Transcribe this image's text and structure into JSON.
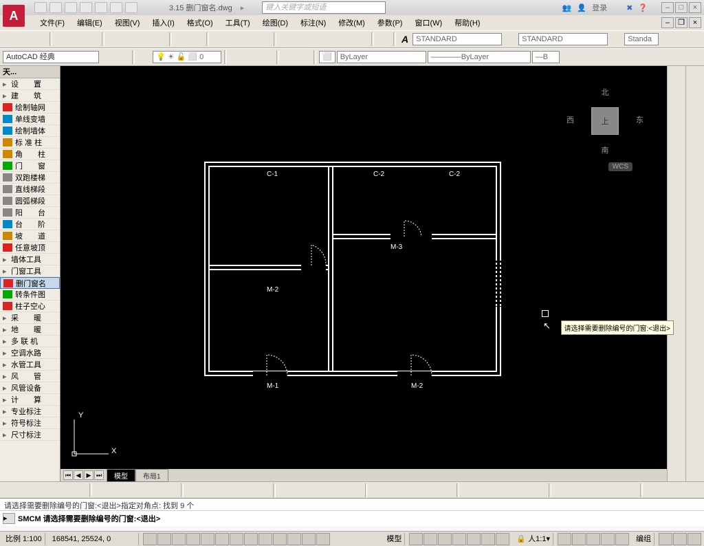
{
  "title": "3.15 删门窗名.dwg",
  "search_placeholder": "键入关键字或短语",
  "login_label": "登录",
  "menus": [
    "文件(F)",
    "编辑(E)",
    "视图(V)",
    "插入(I)",
    "格式(O)",
    "工具(T)",
    "绘图(D)",
    "标注(N)",
    "修改(M)",
    "参数(P)",
    "窗口(W)",
    "帮助(H)"
  ],
  "workspace_combo": "AutoCAD 经典",
  "style_combo1": "STANDARD",
  "style_combo2": "STANDARD",
  "style_combo3": "Standa",
  "layer_combo": "ByLayer",
  "color_combo": "ByLayer",
  "ltype_combo": "B",
  "palette": {
    "title": "天...",
    "items": [
      {
        "label": "设　　置",
        "arrow": true
      },
      {
        "label": "建　　筑",
        "arrow": true
      },
      {
        "label": "绘制轴网",
        "icon": "#d22"
      },
      {
        "label": "单线变墙",
        "icon": "#08c"
      },
      {
        "label": "绘制墙体",
        "icon": "#08c"
      },
      {
        "label": "标 准 柱",
        "icon": "#c80"
      },
      {
        "label": "角　　柱",
        "icon": "#c80"
      },
      {
        "label": "门　　窗",
        "icon": "#0a0"
      },
      {
        "label": "双跑楼梯",
        "icon": "#888"
      },
      {
        "label": "直线梯段",
        "icon": "#888"
      },
      {
        "label": "圆弧梯段",
        "icon": "#888"
      },
      {
        "label": "阳　　台",
        "icon": "#888"
      },
      {
        "label": "台　　阶",
        "icon": "#08c"
      },
      {
        "label": "坡　　道",
        "icon": "#c80"
      },
      {
        "label": "任意坡顶",
        "icon": "#d22"
      },
      {
        "label": "墙体工具",
        "arrow": true
      },
      {
        "label": "门窗工具",
        "arrow": true
      },
      {
        "label": "删门窗名",
        "icon": "#d22",
        "hl": true
      },
      {
        "label": "转条件图",
        "icon": "#0a0"
      },
      {
        "label": "柱子空心",
        "icon": "#d22"
      },
      {
        "label": "采　　暖",
        "arrow": true
      },
      {
        "label": "地　　暖",
        "arrow": true
      },
      {
        "label": "多 联 机",
        "arrow": true
      },
      {
        "label": "空调水路",
        "arrow": true
      },
      {
        "label": "水管工具",
        "arrow": true
      },
      {
        "label": "风　　管",
        "arrow": true
      },
      {
        "label": "风管设备",
        "arrow": true
      },
      {
        "label": "计　　算",
        "arrow": true
      },
      {
        "label": "专业标注",
        "arrow": true
      },
      {
        "label": "符号标注",
        "arrow": true
      },
      {
        "label": "尺寸标注",
        "arrow": true
      }
    ]
  },
  "drawing": {
    "labels": {
      "c1": "C-1",
      "c2a": "C-2",
      "c2b": "C-2",
      "m1": "M-1",
      "m2a": "M-2",
      "m2b": "M-2",
      "m3": "M-3"
    },
    "ucs": {
      "x": "X",
      "y": "Y"
    },
    "compass": {
      "n": "北",
      "s": "南",
      "e": "东",
      "w": "西",
      "top": "上"
    },
    "wcs": "WCS"
  },
  "tooltip": "请选择需要删除编号的门窗:<退出>",
  "tabs": {
    "model": "模型",
    "layout1": "布局1"
  },
  "cmd_history": "请选择需要删除编号的门窗:<退出>指定对角点:  找到  9 个",
  "cmd_prompt": "SMCM 请选择需要删除编号的门窗:<退出>",
  "status": {
    "scale_label": "比例 1:100",
    "coords": "168541, 25524, 0",
    "model_btn": "模型",
    "annoscale": "1:1",
    "group": "编组"
  }
}
